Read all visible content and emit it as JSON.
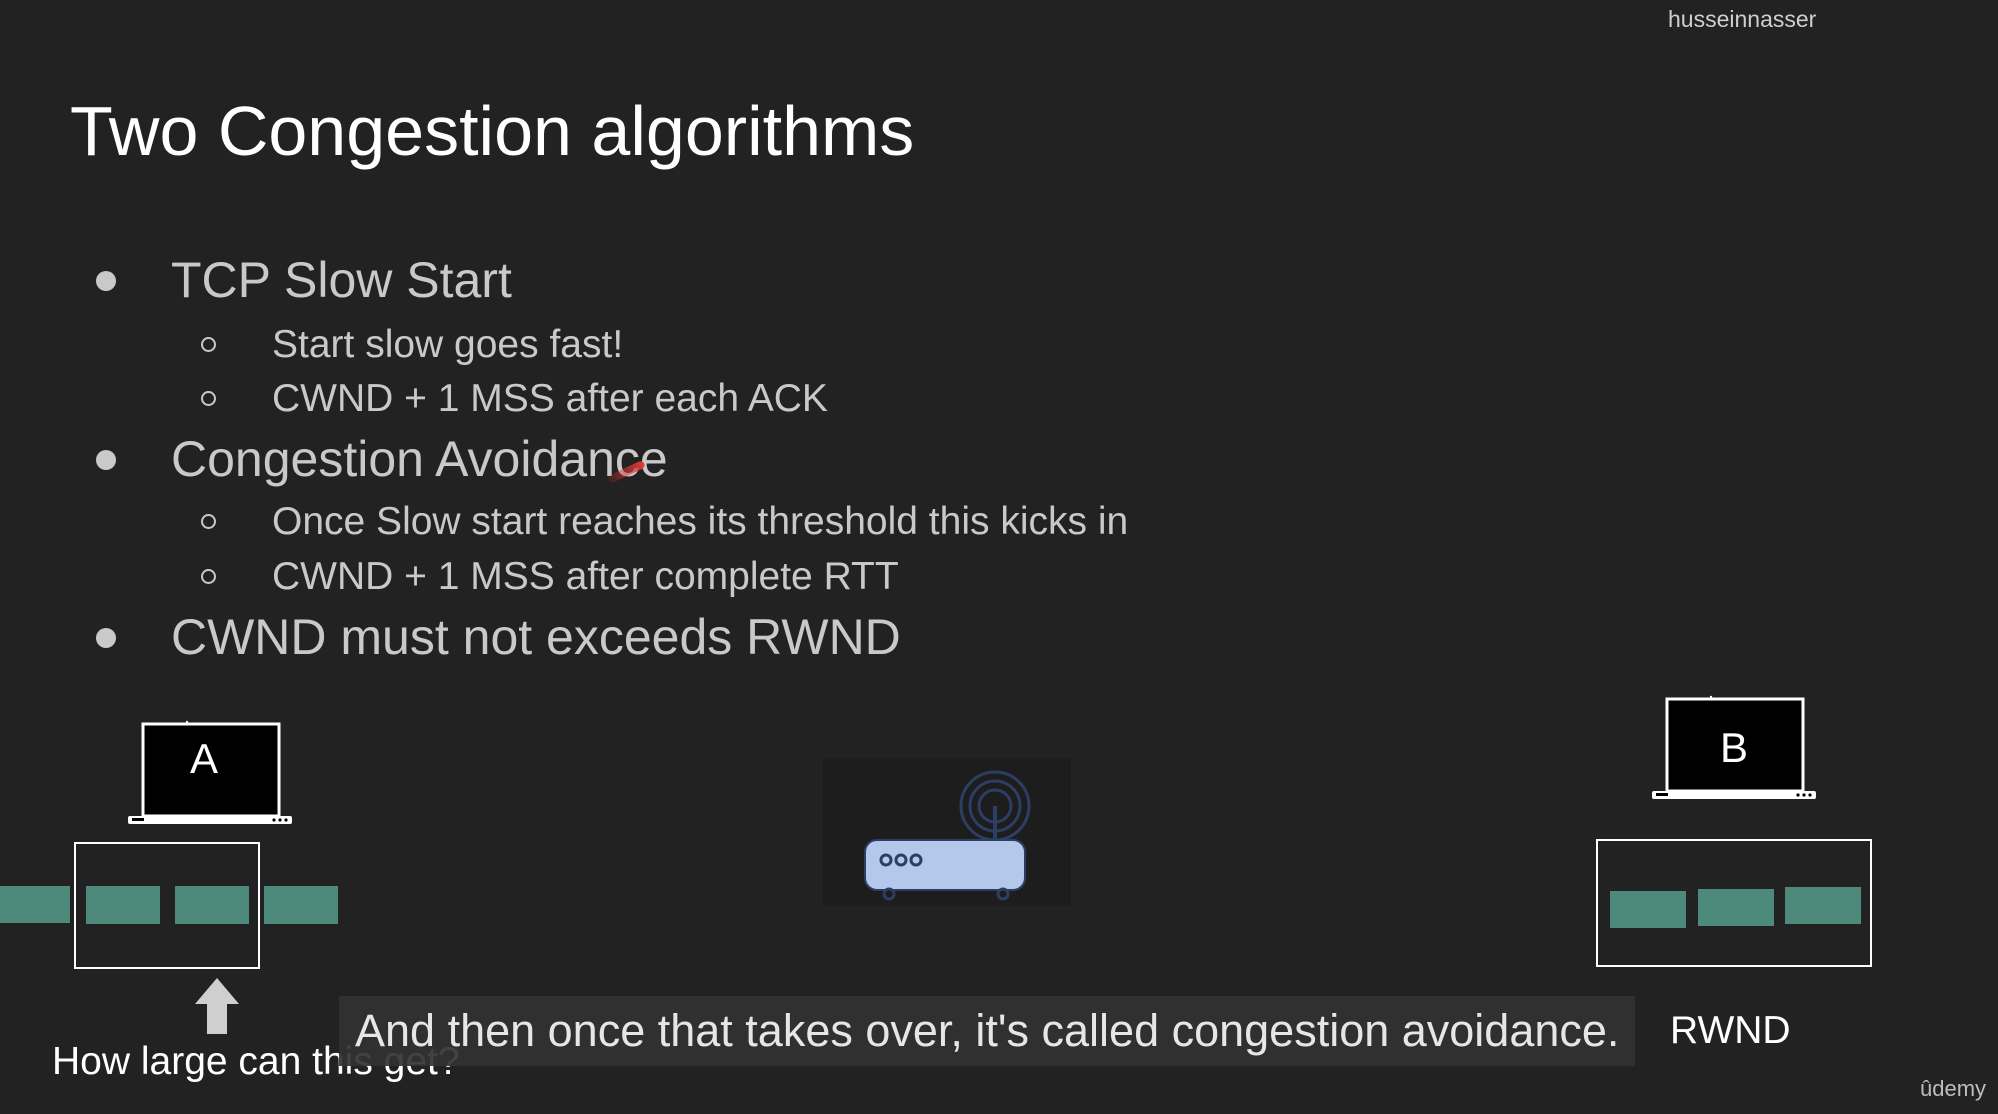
{
  "watermark": "husseinnasser",
  "title": "Two Congestion algorithms",
  "bullets": [
    {
      "text": "TCP Slow Start"
    },
    {
      "text": "Start slow goes fast!"
    },
    {
      "text": "CWND + 1 MSS after each ACK"
    },
    {
      "text": "Congestion Avoidance"
    },
    {
      "text": "Once Slow start reaches its threshold this kicks in"
    },
    {
      "text": "CWND + 1 MSS after complete RTT"
    },
    {
      "text": "CWND must not exceeds RWND"
    }
  ],
  "diagram": {
    "laptop_a_label": "A",
    "laptop_b_label": "B",
    "sender_question": "How large can this get?",
    "receiver_label": "RWND"
  },
  "caption": "And then once that takes over, it's called congestion avoidance.",
  "brand": "ûdemy",
  "colors": {
    "background": "#222222",
    "packet": "#4e8a7c",
    "router": "#b4c8ec",
    "router_outline": "#2c3e63"
  }
}
